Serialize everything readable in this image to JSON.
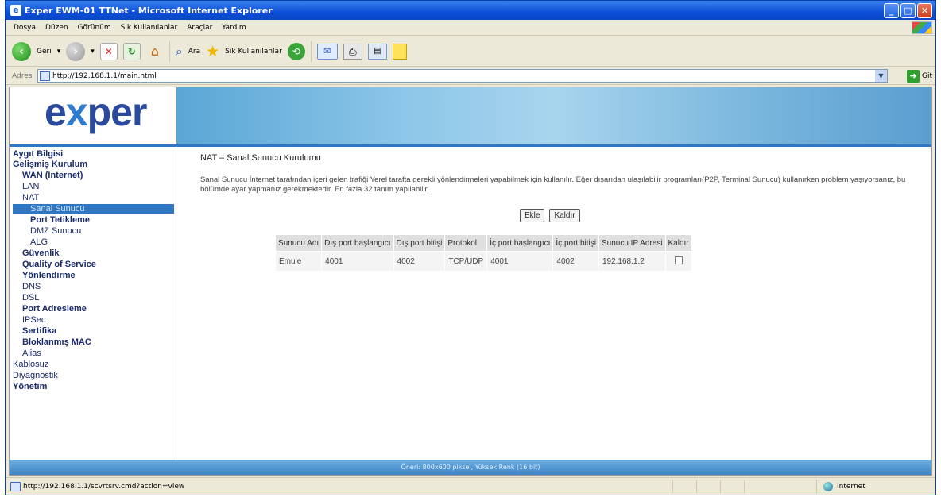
{
  "window": {
    "title": "Exper EWM-01 TTNet - Microsoft Internet Explorer",
    "minimize_glyph": "_",
    "maximize_glyph": "□",
    "close_glyph": "✕"
  },
  "menubar": {
    "items": [
      "Dosya",
      "Düzen",
      "Görünüm",
      "Sık Kullanılanlar",
      "Araçlar",
      "Yardım"
    ]
  },
  "toolbar": {
    "back_label": "Geri",
    "search_label": "Ara",
    "favorites_label": "Sık Kullanılanlar"
  },
  "address": {
    "label": "Adres",
    "url": "http://192.168.1.1/main.html",
    "go_label": "Git"
  },
  "logo": {
    "pre": "e",
    "x": "x",
    "post": "per"
  },
  "sidebar": {
    "items": [
      {
        "label": "Aygıt Bilgisi"
      },
      {
        "label": "Gelişmiş Kurulum"
      },
      {
        "label": "WAN (Internet)"
      },
      {
        "label": "LAN"
      },
      {
        "label": "NAT"
      },
      {
        "label": "Sanal Sunucu"
      },
      {
        "label": "Port Tetikleme"
      },
      {
        "label": "DMZ Sunucu"
      },
      {
        "label": "ALG"
      },
      {
        "label": "Güvenlik"
      },
      {
        "label": "Quality of Service"
      },
      {
        "label": "Yönlendirme"
      },
      {
        "label": "DNS"
      },
      {
        "label": "DSL"
      },
      {
        "label": "Port Adresleme"
      },
      {
        "label": "IPSec"
      },
      {
        "label": "Sertifika"
      },
      {
        "label": "Bloklanmış MAC"
      },
      {
        "label": "Alias"
      },
      {
        "label": "Kablosuz"
      },
      {
        "label": "Diyagnostik"
      },
      {
        "label": "Yönetim"
      }
    ],
    "selected": "Sanal Sunucu"
  },
  "main": {
    "title": "NAT – Sanal Sunucu Kurulumu",
    "description": "Sanal Sunucu İnternet tarafından içeri gelen trafiği Yerel tarafta gerekli yönlendirmeleri yapabilmek için kullanılır. Eğer dışarıdan ulaşılabilir programları(P2P, Terminal Sunucu) kullanırken problem yaşıyorsanız, bu bölümde ayar yapmanız gerekmektedir. En fazla 32 tanım yapılabilir.",
    "add_button": "Ekle",
    "remove_button": "Kaldır",
    "table": {
      "headers": [
        "Sunucu Adı",
        "Dış port başlangıcı",
        "Dış port bitişi",
        "Protokol",
        "İç port başlangıcı",
        "İç port bitişi",
        "Sunucu IP Adresi",
        "Kaldır"
      ],
      "rows": [
        {
          "name": "Emule",
          "ext_start": "4001",
          "ext_end": "4002",
          "protocol": "TCP/UDP",
          "int_start": "4001",
          "int_end": "4002",
          "ip": "192.168.1.2",
          "remove_checked": false
        }
      ]
    }
  },
  "footer": {
    "text": "Öneri: 800x600 piksel, Yüksek Renk (16 bit)"
  },
  "statusbar": {
    "url": "http://192.168.1.1/scvrtsrv.cmd?action=view",
    "zone": "Internet"
  }
}
